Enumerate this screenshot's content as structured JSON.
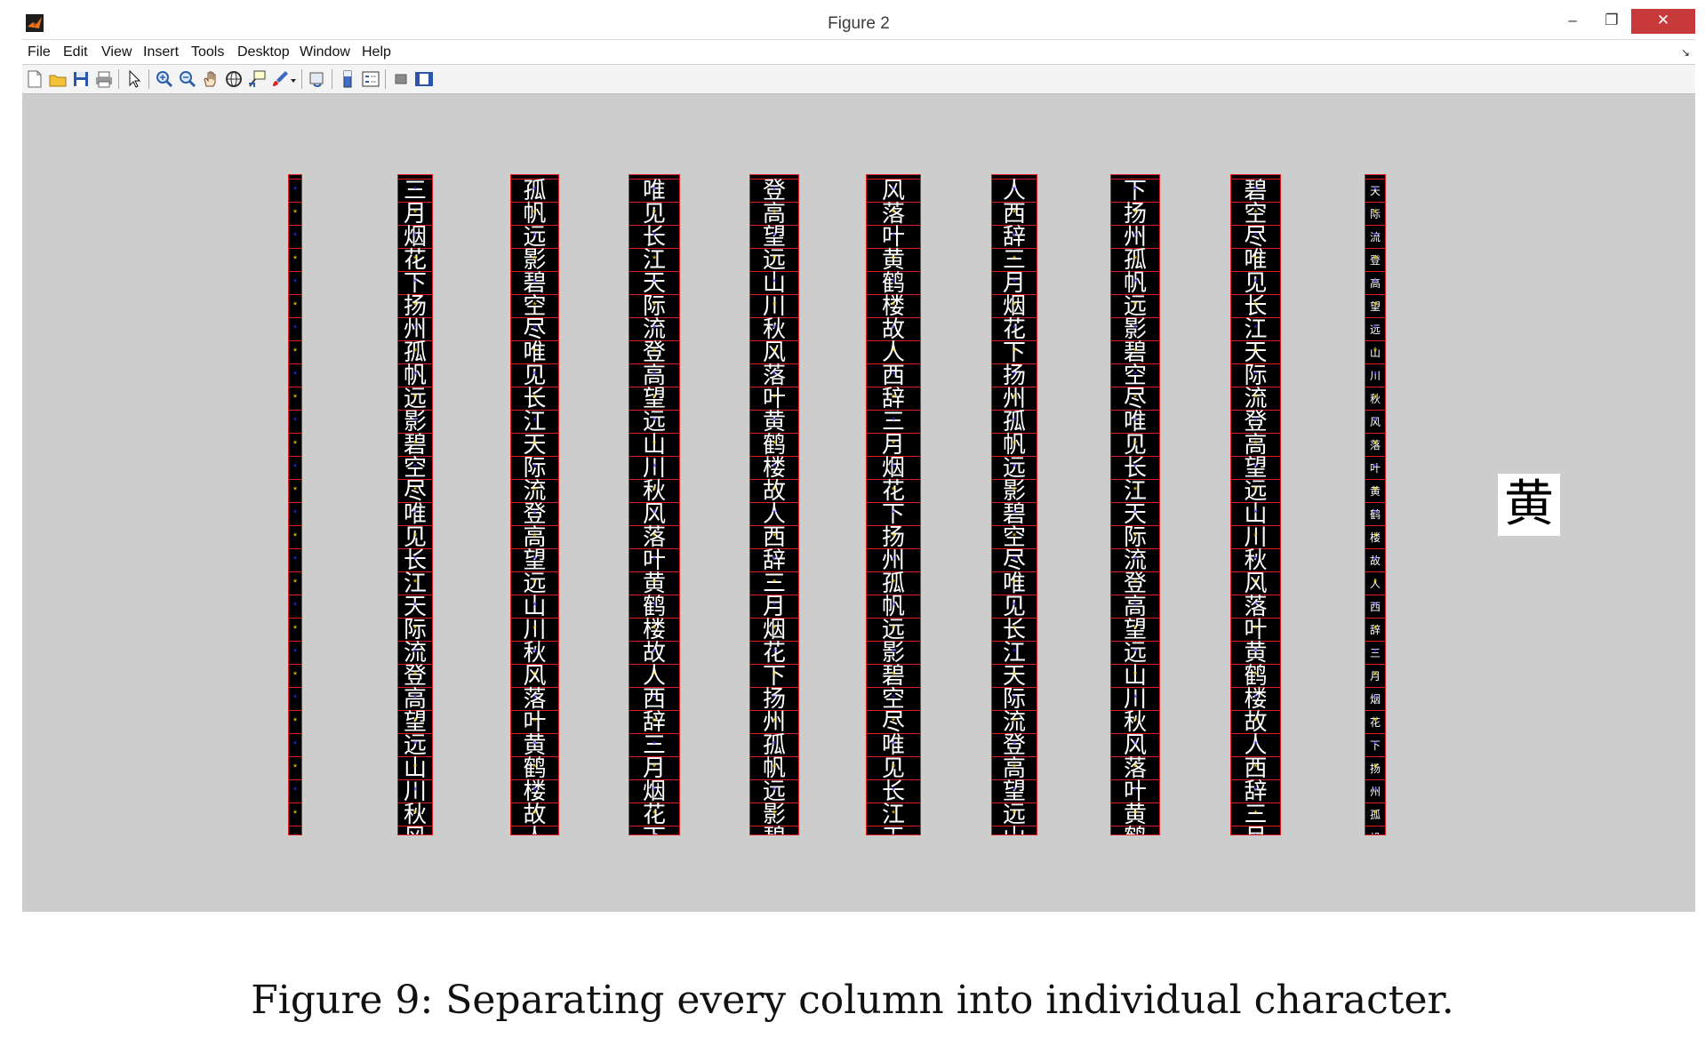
{
  "window": {
    "title": "Figure 2",
    "minimize_glyph": "–",
    "restore_glyph": "❐",
    "close_glyph": "✕"
  },
  "menubar": {
    "items": [
      {
        "label": "File"
      },
      {
        "label": "Edit"
      },
      {
        "label": "View"
      },
      {
        "label": "Insert"
      },
      {
        "label": "Tools"
      },
      {
        "label": "Desktop"
      },
      {
        "label": "Window"
      },
      {
        "label": "Help"
      }
    ],
    "overflow_glyph": "↘"
  },
  "toolbar": {
    "buttons": [
      {
        "name": "new-figure-icon"
      },
      {
        "name": "open-file-icon"
      },
      {
        "name": "save-icon"
      },
      {
        "name": "print-icon"
      },
      {
        "name": "edit-plot-arrow-icon"
      },
      {
        "name": "zoom-in-icon"
      },
      {
        "name": "zoom-out-icon"
      },
      {
        "name": "pan-hand-icon"
      },
      {
        "name": "rotate-3d-icon"
      },
      {
        "name": "data-cursor-icon"
      },
      {
        "name": "brush-icon"
      },
      {
        "name": "link-plot-icon"
      },
      {
        "name": "insert-colorbar-icon"
      },
      {
        "name": "insert-legend-icon"
      },
      {
        "name": "hide-plot-tools-icon"
      },
      {
        "name": "show-plot-tools-icon"
      }
    ]
  },
  "colors": {
    "canvas_bg": "#cdcdcd",
    "column_bg": "#000000",
    "segment_line": "#e02020",
    "centroid_marker": "#2a2aff",
    "boundary_marker": "#ffd400"
  },
  "preview": {
    "character": "黄"
  },
  "caption": "Figure 9: Separating every column into individual character."
}
